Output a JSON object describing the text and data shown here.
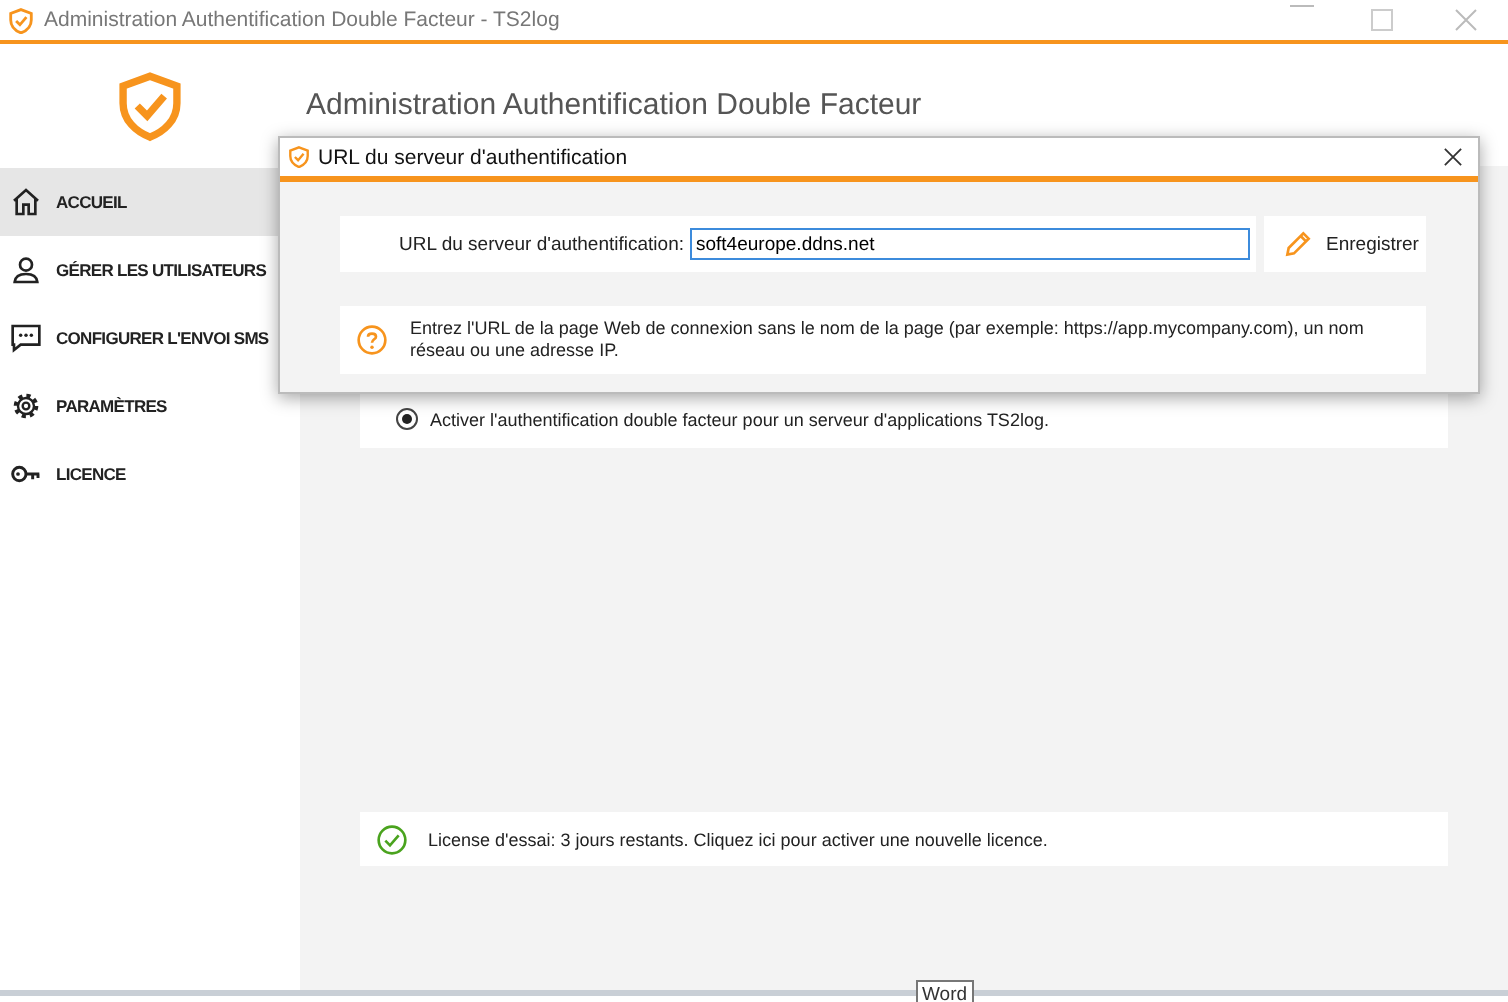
{
  "window": {
    "title": "Administration Authentification Double Facteur - TS2log"
  },
  "sidebar": {
    "items": [
      {
        "label": "ACCUEIL",
        "kind": "home",
        "selected": true
      },
      {
        "label": "GÉRER LES UTILISATEURS",
        "kind": "user",
        "selected": false
      },
      {
        "label": "CONFIGURER L'ENVOI SMS",
        "kind": "chat",
        "selected": false
      },
      {
        "label": "PARAMÈTRES",
        "kind": "gear",
        "selected": false
      },
      {
        "label": "LICENCE",
        "kind": "key",
        "selected": false
      }
    ]
  },
  "header": {
    "title": "Administration Authentification Double Facteur"
  },
  "options": [
    {
      "label": "Activer l'authentification double facteur pour un serveur d'applications TS2log.",
      "selected": true
    }
  ],
  "license": {
    "message": "License d'essai: 3 jours restants. Cliquez ici pour activer une nouvelle licence."
  },
  "dialog": {
    "title": "URL du serveur d'authentification",
    "field_label": "URL du serveur d'authentification:",
    "field_value": "soft4europe.ddns.net",
    "save_button": "Enregistrer",
    "help": "Entrez l'URL de la page Web de connexion sans le nom de la page (par exemple: https://app.mycompany.com), un nom réseau ou une adresse IP."
  },
  "tooltip": "Word"
}
